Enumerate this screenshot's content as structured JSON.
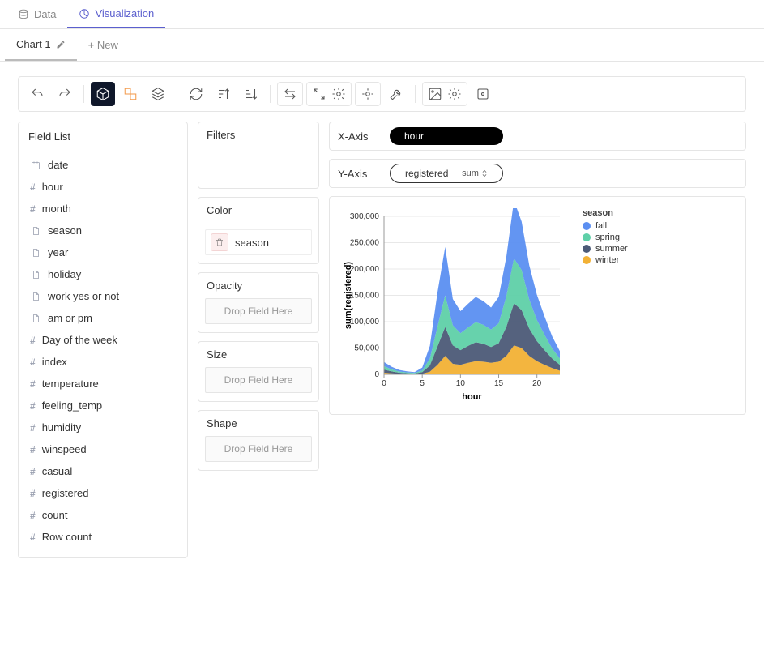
{
  "topTabs": {
    "data": "Data",
    "viz": "Visualization"
  },
  "chartTab": "Chart 1",
  "newTab": "+ New",
  "fieldListTitle": "Field List",
  "fields": [
    {
      "type": "date",
      "name": "date"
    },
    {
      "type": "num",
      "name": "hour"
    },
    {
      "type": "num",
      "name": "month"
    },
    {
      "type": "doc",
      "name": "season"
    },
    {
      "type": "doc",
      "name": "year"
    },
    {
      "type": "doc",
      "name": "holiday"
    },
    {
      "type": "doc",
      "name": "work yes or not"
    },
    {
      "type": "doc",
      "name": "am or pm"
    },
    {
      "type": "num",
      "name": "Day of the week"
    },
    {
      "type": "num",
      "name": "index"
    },
    {
      "type": "num",
      "name": "temperature"
    },
    {
      "type": "num",
      "name": "feeling_temp"
    },
    {
      "type": "num",
      "name": "humidity"
    },
    {
      "type": "num",
      "name": "winspeed"
    },
    {
      "type": "num",
      "name": "casual"
    },
    {
      "type": "num",
      "name": "registered"
    },
    {
      "type": "num",
      "name": "count"
    },
    {
      "type": "num",
      "name": "Row count"
    }
  ],
  "shelves": {
    "filters": "Filters",
    "color": "Color",
    "opacity": "Opacity",
    "size": "Size",
    "shape": "Shape",
    "dropHint": "Drop Field Here",
    "colorChip": "season"
  },
  "axes": {
    "xLabel": "X-Axis",
    "yLabel": "Y-Axis",
    "xField": "hour",
    "yField": "registered",
    "yAgg": "sum"
  },
  "chart_data": {
    "type": "area",
    "xlabel": "hour",
    "ylabel": "sum(registered)",
    "x": [
      0,
      1,
      2,
      3,
      4,
      5,
      6,
      7,
      8,
      9,
      10,
      11,
      12,
      13,
      14,
      15,
      16,
      17,
      18,
      19,
      20,
      21,
      22,
      23
    ],
    "xlim": [
      0,
      23
    ],
    "ylim": [
      0,
      300000
    ],
    "yticks": [
      0,
      50000,
      100000,
      150000,
      200000,
      250000,
      300000
    ],
    "xticks": [
      0,
      5,
      10,
      15,
      20
    ],
    "legend_title": "season",
    "series": [
      {
        "name": "winter",
        "color": "#f2b135",
        "values": [
          3000,
          2000,
          1000,
          800,
          600,
          1200,
          5000,
          18000,
          35000,
          20000,
          18000,
          22000,
          25000,
          24000,
          22000,
          24000,
          35000,
          55000,
          50000,
          35000,
          25000,
          18000,
          12000,
          7000
        ]
      },
      {
        "name": "summer",
        "color": "#4c5a77",
        "values": [
          6000,
          3500,
          2000,
          1400,
          1000,
          3000,
          12000,
          35000,
          55000,
          35000,
          28000,
          32000,
          36000,
          34000,
          30000,
          35000,
          55000,
          80000,
          72000,
          52000,
          38000,
          28000,
          18000,
          11000
        ]
      },
      {
        "name": "spring",
        "color": "#5fd0a8",
        "values": [
          6500,
          4000,
          2200,
          1500,
          1100,
          3200,
          13000,
          38000,
          60000,
          38000,
          32000,
          35000,
          38000,
          36000,
          33000,
          38000,
          58000,
          85000,
          76000,
          55000,
          40000,
          29000,
          19000,
          12000
        ]
      },
      {
        "name": "fall",
        "color": "#5b8ff1",
        "values": [
          8000,
          5000,
          3000,
          2000,
          1500,
          5500,
          24000,
          65000,
          92000,
          50000,
          42000,
          45000,
          48000,
          45000,
          42000,
          50000,
          75000,
          110000,
          92000,
          65000,
          48000,
          35000,
          23000,
          14000
        ]
      }
    ]
  }
}
